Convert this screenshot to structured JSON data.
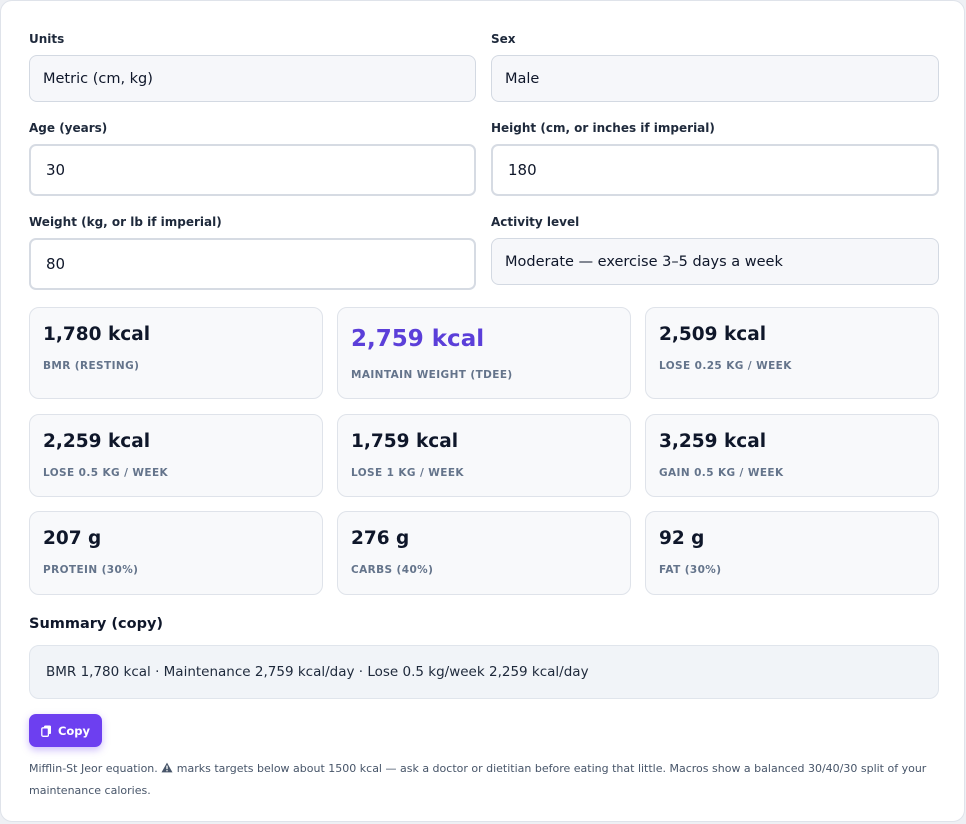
{
  "form": {
    "units": {
      "label": "Units",
      "value": "Metric (cm, kg)"
    },
    "sex": {
      "label": "Sex",
      "value": "Male"
    },
    "age": {
      "label": "Age (years)",
      "value": "30"
    },
    "height": {
      "label": "Height (cm, or inches if imperial)",
      "value": "180"
    },
    "weight": {
      "label": "Weight (kg, or lb if imperial)",
      "value": "80"
    },
    "activity": {
      "label": "Activity level",
      "value": "Moderate — exercise 3–5 days a week"
    }
  },
  "results": [
    {
      "value": "1,780 kcal",
      "caption": "BMR (RESTING)"
    },
    {
      "value": "2,759 kcal",
      "caption": "MAINTAIN WEIGHT (TDEE)"
    },
    {
      "value": "2,509 kcal",
      "caption": "LOSE 0.25 KG / WEEK"
    },
    {
      "value": "2,259 kcal",
      "caption": "LOSE 0.5 KG / WEEK"
    },
    {
      "value": "1,759 kcal",
      "caption": "LOSE 1 KG / WEEK"
    },
    {
      "value": "3,259 kcal",
      "caption": "GAIN 0.5 KG / WEEK"
    }
  ],
  "macros": [
    {
      "value": "207 g",
      "caption": "PROTEIN (30%)"
    },
    {
      "value": "276 g",
      "caption": "CARBS (40%)"
    },
    {
      "value": "92 g",
      "caption": "FAT (30%)"
    }
  ],
  "summary": {
    "title": "Summary (copy)",
    "text": "BMR 1,780 kcal · Maintenance 2,759 kcal/day · Lose 0.5 kg/week 2,259 kcal/day"
  },
  "copy_button": {
    "label": "Copy",
    "icon": "copy-icon"
  },
  "note": {
    "before": "Mifflin-St Jeor equation.",
    "icon": "warning-icon",
    "after": "marks targets below about 1500 kcal — ask a doctor or dietitian before eating that little. Macros show a balanced 30/40/30 split of your maintenance calories."
  },
  "colors": {
    "accent": "#5b3fd9",
    "button": "#6d3ff0"
  }
}
